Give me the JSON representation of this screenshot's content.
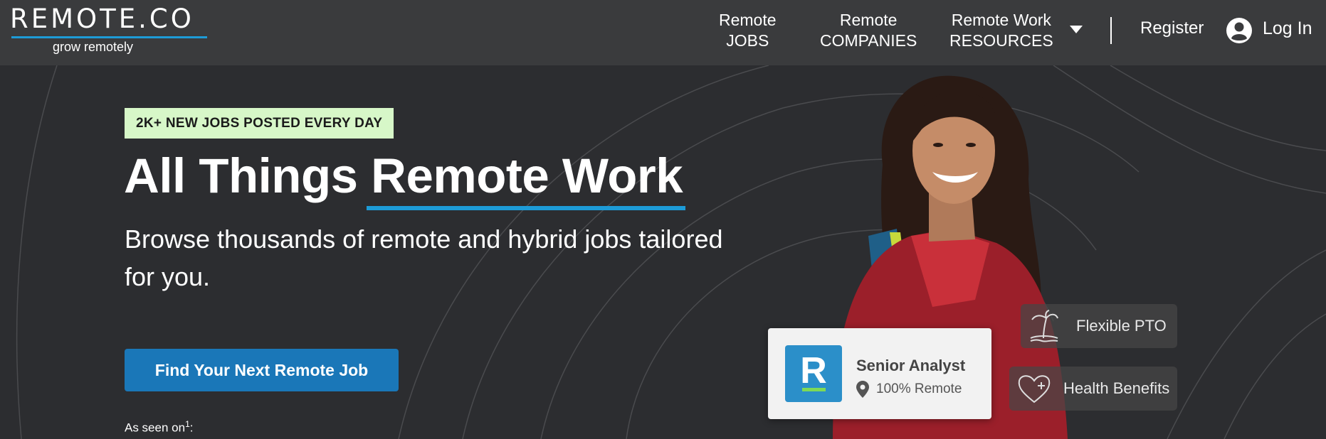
{
  "header": {
    "logo_text": "REMOTE.CO",
    "logo_tagline": "grow remotely",
    "nav": [
      {
        "line1": "Remote",
        "line2": "JOBS"
      },
      {
        "line1": "Remote",
        "line2": "COMPANIES"
      },
      {
        "line1": "Remote Work",
        "line2": "RESOURCES"
      }
    ],
    "register": "Register",
    "login": "Log In"
  },
  "hero": {
    "badge": "2K+ NEW JOBS POSTED EVERY DAY",
    "headline_part1": "All Things ",
    "headline_part2": "Remote Work",
    "subline": "Browse thousands of remote and hybrid jobs tailored for you.",
    "cta": "Find Your Next Remote Job",
    "seen_on": "As seen on",
    "seen_on_sup": "1",
    "seen_on_suffix": ":"
  },
  "job_card": {
    "logo_letter": "R",
    "title": "Senior Analyst",
    "location": "100% Remote"
  },
  "perks": [
    {
      "label": "Flexible PTO",
      "icon": "palm-tree-icon"
    },
    {
      "label": "Health Benefits",
      "icon": "heart-plus-icon"
    }
  ],
  "colors": {
    "accent": "#1d9bd7",
    "cta": "#1a77b8",
    "badge_bg": "#d7f7c8",
    "background": "#2c2d30",
    "topbar": "#3a3b3d"
  }
}
